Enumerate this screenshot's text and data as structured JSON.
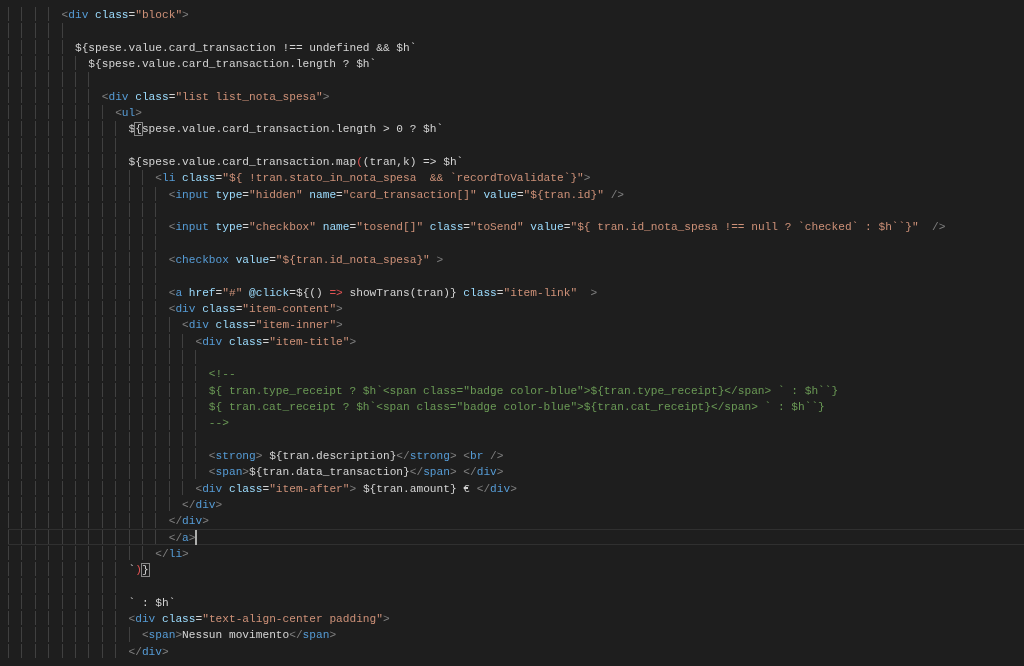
{
  "editor": {
    "lines": [
      {
        "kind": "code",
        "current": false,
        "tokens": [
          {
            "kind": "punct",
            "text": "        <"
          },
          {
            "kind": "tag",
            "text": "div"
          },
          {
            "kind": "attr",
            "text": " class"
          },
          {
            "kind": "text",
            "text": "="
          },
          {
            "kind": "string",
            "text": "\"block\""
          },
          {
            "kind": "punct",
            "text": ">"
          }
        ]
      },
      {
        "kind": "blank"
      },
      {
        "kind": "code",
        "current": false,
        "tokens": [
          {
            "kind": "text",
            "text": "          ${spese.value.card_transaction !== undefined && $h`"
          }
        ]
      },
      {
        "kind": "code",
        "current": false,
        "tokens": [
          {
            "kind": "text",
            "text": "            ${spese.value.card_transaction.length ? $h`"
          }
        ]
      },
      {
        "kind": "blank"
      },
      {
        "kind": "code",
        "current": false,
        "tokens": [
          {
            "kind": "punct",
            "text": "              <"
          },
          {
            "kind": "tag",
            "text": "div"
          },
          {
            "kind": "attr",
            "text": " class"
          },
          {
            "kind": "text",
            "text": "="
          },
          {
            "kind": "string",
            "text": "\"list list_nota_spesa\""
          },
          {
            "kind": "punct",
            "text": ">"
          }
        ]
      },
      {
        "kind": "code",
        "current": false,
        "tokens": [
          {
            "kind": "punct",
            "text": "                <"
          },
          {
            "kind": "tag",
            "text": "ul"
          },
          {
            "kind": "punct",
            "text": ">"
          }
        ]
      },
      {
        "kind": "code",
        "current": false,
        "tokens": [
          {
            "kind": "text",
            "text": "                  $"
          },
          {
            "kind": "matched",
            "text": "{"
          },
          {
            "kind": "text",
            "text": "spese.value.card_transaction.length > 0 ? $h`"
          }
        ]
      },
      {
        "kind": "blank"
      },
      {
        "kind": "code",
        "current": false,
        "tokens": [
          {
            "kind": "text",
            "text": "                  ${spese.value.card_transaction.map"
          },
          {
            "kind": "paren",
            "text": "("
          },
          {
            "kind": "text",
            "text": "(tran,k) => $h`"
          }
        ]
      },
      {
        "kind": "code",
        "current": false,
        "tokens": [
          {
            "kind": "punct",
            "text": "                      <"
          },
          {
            "kind": "tag",
            "text": "li"
          },
          {
            "kind": "attr",
            "text": " class"
          },
          {
            "kind": "text",
            "text": "="
          },
          {
            "kind": "string",
            "text": "\"${ !tran.stato_in_nota_spesa  && `recordToValidate`}\""
          },
          {
            "kind": "punct",
            "text": ">"
          }
        ]
      },
      {
        "kind": "code",
        "current": false,
        "tokens": [
          {
            "kind": "punct",
            "text": "                        <"
          },
          {
            "kind": "tag",
            "text": "input"
          },
          {
            "kind": "attr",
            "text": " type"
          },
          {
            "kind": "text",
            "text": "="
          },
          {
            "kind": "string",
            "text": "\"hidden\""
          },
          {
            "kind": "attr",
            "text": " name"
          },
          {
            "kind": "text",
            "text": "="
          },
          {
            "kind": "string",
            "text": "\"card_transaction[]\""
          },
          {
            "kind": "attr",
            "text": " value"
          },
          {
            "kind": "text",
            "text": "="
          },
          {
            "kind": "string",
            "text": "\"${tran.id}\""
          },
          {
            "kind": "punct",
            "text": " />"
          }
        ]
      },
      {
        "kind": "blank"
      },
      {
        "kind": "code",
        "current": false,
        "tokens": [
          {
            "kind": "punct",
            "text": "                        <"
          },
          {
            "kind": "tag",
            "text": "input"
          },
          {
            "kind": "attr",
            "text": " type"
          },
          {
            "kind": "text",
            "text": "="
          },
          {
            "kind": "string",
            "text": "\"checkbox\""
          },
          {
            "kind": "attr",
            "text": " name"
          },
          {
            "kind": "text",
            "text": "="
          },
          {
            "kind": "string",
            "text": "\"tosend[]\""
          },
          {
            "kind": "attr",
            "text": " class"
          },
          {
            "kind": "text",
            "text": "="
          },
          {
            "kind": "string",
            "text": "\"toSend\""
          },
          {
            "kind": "attr",
            "text": " value"
          },
          {
            "kind": "text",
            "text": "="
          },
          {
            "kind": "string",
            "text": "\"${ tran.id_nota_spesa !== null ? `checked` : $h``}\""
          },
          {
            "kind": "punct",
            "text": "  />"
          }
        ]
      },
      {
        "kind": "blank"
      },
      {
        "kind": "code",
        "current": false,
        "tokens": [
          {
            "kind": "punct",
            "text": "                        <"
          },
          {
            "kind": "tag",
            "text": "checkbox"
          },
          {
            "kind": "attr",
            "text": " value"
          },
          {
            "kind": "text",
            "text": "="
          },
          {
            "kind": "string",
            "text": "\"${tran.id_nota_spesa}\""
          },
          {
            "kind": "punct",
            "text": " >"
          }
        ]
      },
      {
        "kind": "blank"
      },
      {
        "kind": "code",
        "current": false,
        "tokens": [
          {
            "kind": "punct",
            "text": "                        <"
          },
          {
            "kind": "tag",
            "text": "a"
          },
          {
            "kind": "attr",
            "text": " href"
          },
          {
            "kind": "text",
            "text": "="
          },
          {
            "kind": "string",
            "text": "\"#\""
          },
          {
            "kind": "attr",
            "text": " @click"
          },
          {
            "kind": "text",
            "text": "=${() "
          },
          {
            "kind": "paren",
            "text": "=>"
          },
          {
            "kind": "text",
            "text": " showTrans(tran)}"
          },
          {
            "kind": "attr",
            "text": " class"
          },
          {
            "kind": "text",
            "text": "="
          },
          {
            "kind": "string",
            "text": "\"item-link\""
          },
          {
            "kind": "punct",
            "text": "  >"
          }
        ]
      },
      {
        "kind": "code",
        "current": false,
        "tokens": [
          {
            "kind": "punct",
            "text": "                        <"
          },
          {
            "kind": "tag",
            "text": "div"
          },
          {
            "kind": "attr",
            "text": " class"
          },
          {
            "kind": "text",
            "text": "="
          },
          {
            "kind": "string",
            "text": "\"item-content\""
          },
          {
            "kind": "punct",
            "text": ">"
          }
        ]
      },
      {
        "kind": "code",
        "current": false,
        "tokens": [
          {
            "kind": "punct",
            "text": "                          <"
          },
          {
            "kind": "tag",
            "text": "div"
          },
          {
            "kind": "attr",
            "text": " class"
          },
          {
            "kind": "text",
            "text": "="
          },
          {
            "kind": "string",
            "text": "\"item-inner\""
          },
          {
            "kind": "punct",
            "text": ">"
          }
        ]
      },
      {
        "kind": "code",
        "current": false,
        "tokens": [
          {
            "kind": "punct",
            "text": "                            <"
          },
          {
            "kind": "tag",
            "text": "div"
          },
          {
            "kind": "attr",
            "text": " class"
          },
          {
            "kind": "text",
            "text": "="
          },
          {
            "kind": "string",
            "text": "\"item-title\""
          },
          {
            "kind": "punct",
            "text": ">"
          }
        ]
      },
      {
        "kind": "blank"
      },
      {
        "kind": "code",
        "current": false,
        "tokens": [
          {
            "kind": "comment",
            "text": "                              <!--"
          }
        ]
      },
      {
        "kind": "code",
        "current": false,
        "tokens": [
          {
            "kind": "comment",
            "text": "                              ${ tran.type_receipt ? $h`<span class=\"badge color-blue\">${tran.type_receipt}</span> ` : $h``}"
          }
        ]
      },
      {
        "kind": "code",
        "current": false,
        "tokens": [
          {
            "kind": "comment",
            "text": "                              ${ tran.cat_receipt ? $h`<span class=\"badge color-blue\">${tran.cat_receipt}</span> ` : $h``}"
          }
        ]
      },
      {
        "kind": "code",
        "current": false,
        "tokens": [
          {
            "kind": "comment",
            "text": "                              -->"
          }
        ]
      },
      {
        "kind": "blank"
      },
      {
        "kind": "code",
        "current": false,
        "tokens": [
          {
            "kind": "punct",
            "text": "                              <"
          },
          {
            "kind": "tag",
            "text": "strong"
          },
          {
            "kind": "punct",
            "text": ">"
          },
          {
            "kind": "text",
            "text": " ${tran.description}"
          },
          {
            "kind": "punct",
            "text": "</"
          },
          {
            "kind": "tag",
            "text": "strong"
          },
          {
            "kind": "punct",
            "text": "> <"
          },
          {
            "kind": "tag",
            "text": "br"
          },
          {
            "kind": "punct",
            "text": " />"
          }
        ]
      },
      {
        "kind": "code",
        "current": false,
        "tokens": [
          {
            "kind": "punct",
            "text": "                              <"
          },
          {
            "kind": "tag",
            "text": "span"
          },
          {
            "kind": "punct",
            "text": ">"
          },
          {
            "kind": "text",
            "text": "${tran.data_transaction}"
          },
          {
            "kind": "punct",
            "text": "</"
          },
          {
            "kind": "tag",
            "text": "span"
          },
          {
            "kind": "punct",
            "text": "> </"
          },
          {
            "kind": "tag",
            "text": "div"
          },
          {
            "kind": "punct",
            "text": ">"
          }
        ]
      },
      {
        "kind": "code",
        "current": false,
        "tokens": [
          {
            "kind": "punct",
            "text": "                            <"
          },
          {
            "kind": "tag",
            "text": "div"
          },
          {
            "kind": "attr",
            "text": " class"
          },
          {
            "kind": "text",
            "text": "="
          },
          {
            "kind": "string",
            "text": "\"item-after\""
          },
          {
            "kind": "punct",
            "text": ">"
          },
          {
            "kind": "text",
            "text": " ${tran.amount} € "
          },
          {
            "kind": "punct",
            "text": "</"
          },
          {
            "kind": "tag",
            "text": "div"
          },
          {
            "kind": "punct",
            "text": ">"
          }
        ]
      },
      {
        "kind": "code",
        "current": false,
        "tokens": [
          {
            "kind": "punct",
            "text": "                          </"
          },
          {
            "kind": "tag",
            "text": "div"
          },
          {
            "kind": "punct",
            "text": ">"
          }
        ]
      },
      {
        "kind": "code",
        "current": false,
        "tokens": [
          {
            "kind": "punct",
            "text": "                        </"
          },
          {
            "kind": "tag",
            "text": "div"
          },
          {
            "kind": "punct",
            "text": ">"
          }
        ]
      },
      {
        "kind": "code",
        "current": true,
        "tokens": [
          {
            "kind": "punct",
            "text": "                        </"
          },
          {
            "kind": "tag",
            "text": "a"
          },
          {
            "kind": "punct",
            "text": ">"
          }
        ]
      },
      {
        "kind": "code",
        "current": false,
        "tokens": [
          {
            "kind": "punct",
            "text": "                      </"
          },
          {
            "kind": "tag",
            "text": "li"
          },
          {
            "kind": "punct",
            "text": ">"
          }
        ]
      },
      {
        "kind": "code",
        "current": false,
        "tokens": [
          {
            "kind": "text",
            "text": "                  `"
          },
          {
            "kind": "paren",
            "text": ")"
          },
          {
            "kind": "matched",
            "text": "}"
          }
        ]
      },
      {
        "kind": "blank"
      },
      {
        "kind": "code",
        "current": false,
        "tokens": [
          {
            "kind": "text",
            "text": "                  ` : $h`"
          }
        ]
      },
      {
        "kind": "code",
        "current": false,
        "tokens": [
          {
            "kind": "punct",
            "text": "                  <"
          },
          {
            "kind": "tag",
            "text": "div"
          },
          {
            "kind": "attr",
            "text": " class"
          },
          {
            "kind": "text",
            "text": "="
          },
          {
            "kind": "string",
            "text": "\"text-align-center padding\""
          },
          {
            "kind": "punct",
            "text": ">"
          }
        ]
      },
      {
        "kind": "code",
        "current": false,
        "tokens": [
          {
            "kind": "punct",
            "text": "                    <"
          },
          {
            "kind": "tag",
            "text": "span"
          },
          {
            "kind": "punct",
            "text": ">"
          },
          {
            "kind": "text",
            "text": "Nessun movimento"
          },
          {
            "kind": "punct",
            "text": "</"
          },
          {
            "kind": "tag",
            "text": "span"
          },
          {
            "kind": "punct",
            "text": ">"
          }
        ]
      },
      {
        "kind": "code",
        "current": false,
        "tokens": [
          {
            "kind": "punct",
            "text": "                  </"
          },
          {
            "kind": "tag",
            "text": "div"
          },
          {
            "kind": "punct",
            "text": ">"
          }
        ]
      }
    ]
  }
}
